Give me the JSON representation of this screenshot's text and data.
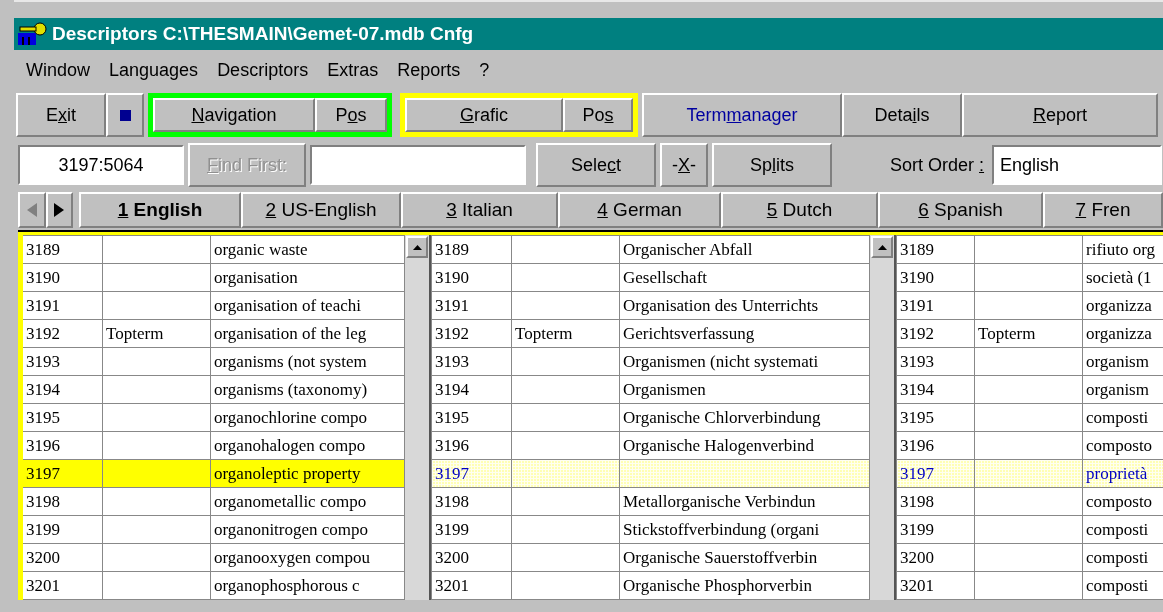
{
  "window": {
    "title": "Descriptors C:\\THESMAIN\\Gemet-07.mdb Cnfg"
  },
  "menu": [
    "Window",
    "Languages",
    "Descriptors",
    "Extras",
    "Reports",
    "?"
  ],
  "toolbar": [
    {
      "kind": "button",
      "pre": "E",
      "key": "x",
      "post": "it",
      "highlighted": false
    },
    {
      "kind": "square"
    },
    {
      "kind": "group",
      "color": "#00ff00",
      "buttons": [
        {
          "key": "N",
          "post": "avigation"
        },
        {
          "pre": "P",
          "key": "o",
          "post": "s"
        }
      ]
    },
    {
      "kind": "group",
      "color": "#ffff00",
      "buttons": [
        {
          "key": "G",
          "post": "rafic"
        },
        {
          "pre": "Po",
          "key": "s"
        }
      ]
    },
    {
      "kind": "button",
      "pre": "Term",
      "key": "m",
      "post": "anager",
      "highlighted": true
    },
    {
      "kind": "button",
      "pre": "Deta",
      "key": "i",
      "post": "ls",
      "highlighted": false
    },
    {
      "kind": "button",
      "key": "R",
      "post": "eport",
      "highlighted": false
    }
  ],
  "search_bar": {
    "position": "3197:5064",
    "find_first": {
      "key": "F",
      "post": "ind First:",
      "disabled": true
    },
    "buttons": [
      {
        "pre": "Sele",
        "key": "c",
        "post": "t"
      },
      {
        "pre": "-",
        "key": "X",
        "post": "-"
      },
      {
        "pre": "Sp",
        "key": "l",
        "post": "its"
      }
    ],
    "sort_order": {
      "pre": "Sort Order ",
      "key": ":",
      "value": "English"
    }
  },
  "language_tabs": {
    "prev_disabled": true,
    "tabs": [
      {
        "key": "1",
        "post": " English",
        "selected": true
      },
      {
        "key": "2",
        "post": " US-English",
        "selected": false
      },
      {
        "key": "3",
        "post": " Italian",
        "selected": false
      },
      {
        "key": "4",
        "post": " German",
        "selected": false
      },
      {
        "key": "5",
        "post": " Dutch",
        "selected": false
      },
      {
        "key": "6",
        "post": " Spanish",
        "selected": false
      },
      {
        "key": "7",
        "post": " Fren",
        "selected": false
      }
    ]
  },
  "grids": [
    {
      "active": true,
      "rows": [
        {
          "id": "3189",
          "term": "organic waste",
          "selected": false
        },
        {
          "id": "3190",
          "term": "organisation",
          "selected": false
        },
        {
          "id": "3191",
          "term": "organisation of teachi",
          "selected": false
        },
        {
          "id": "3192",
          "type": "Topterm",
          "term": "organisation of the leg",
          "selected": false
        },
        {
          "id": "3193",
          "term": "organisms (not system",
          "selected": false
        },
        {
          "id": "3194",
          "term": "organisms (taxonomy)",
          "selected": false
        },
        {
          "id": "3195",
          "term": "organochlorine compo",
          "selected": false
        },
        {
          "id": "3196",
          "term": "organohalogen compo",
          "selected": false
        },
        {
          "id": "3197",
          "term": "organoleptic property",
          "selected": true
        },
        {
          "id": "3198",
          "term": "organometallic compo",
          "selected": false
        },
        {
          "id": "3199",
          "term": "organonitrogen compo",
          "selected": false
        },
        {
          "id": "3200",
          "term": "organooxygen compou",
          "selected": false
        },
        {
          "id": "3201",
          "term": "organophosphorous c",
          "selected": false
        }
      ]
    },
    {
      "active": false,
      "rows": [
        {
          "id": "3189",
          "term": "Organischer Abfall",
          "selected": false
        },
        {
          "id": "3190",
          "term": "Gesellschaft",
          "selected": false
        },
        {
          "id": "3191",
          "term": "Organisation des Unterrichts",
          "selected": false
        },
        {
          "id": "3192",
          "type": "Topterm",
          "term": "Gerichtsverfassung",
          "selected": false
        },
        {
          "id": "3193",
          "term": "Organismen (nicht systemati",
          "selected": false
        },
        {
          "id": "3194",
          "term": "Organismen",
          "selected": false
        },
        {
          "id": "3195",
          "term": "Organische Chlorverbindung",
          "selected": false
        },
        {
          "id": "3196",
          "term": "Organische Halogenverbind",
          "selected": false
        },
        {
          "id": "3197",
          "selected": true
        },
        {
          "id": "3198",
          "term": "Metallorganische Verbindun",
          "selected": false
        },
        {
          "id": "3199",
          "term": "Stickstoffverbindung (organi",
          "selected": false
        },
        {
          "id": "3200",
          "term": "Organische Sauerstoffverbin",
          "selected": false
        },
        {
          "id": "3201",
          "term": "Organische Phosphorverbin",
          "selected": false
        }
      ]
    },
    {
      "active": false,
      "rows": [
        {
          "id": "3189",
          "term": "rifiuto org",
          "selected": false
        },
        {
          "id": "3190",
          "term": "società (1",
          "selected": false
        },
        {
          "id": "3191",
          "term": "organizza",
          "selected": false
        },
        {
          "id": "3192",
          "type": "Topterm",
          "term": "organizza",
          "selected": false
        },
        {
          "id": "3193",
          "term": "organism",
          "selected": false
        },
        {
          "id": "3194",
          "term": "organism",
          "selected": false
        },
        {
          "id": "3195",
          "term": "composti",
          "selected": false
        },
        {
          "id": "3196",
          "term": "composto",
          "selected": false
        },
        {
          "id": "3197",
          "term": "proprietà",
          "selected": true
        },
        {
          "id": "3198",
          "term": "composto",
          "selected": false
        },
        {
          "id": "3199",
          "term": "composti",
          "selected": false
        },
        {
          "id": "3200",
          "term": "composti",
          "selected": false
        },
        {
          "id": "3201",
          "term": "composti",
          "selected": false
        }
      ]
    }
  ]
}
